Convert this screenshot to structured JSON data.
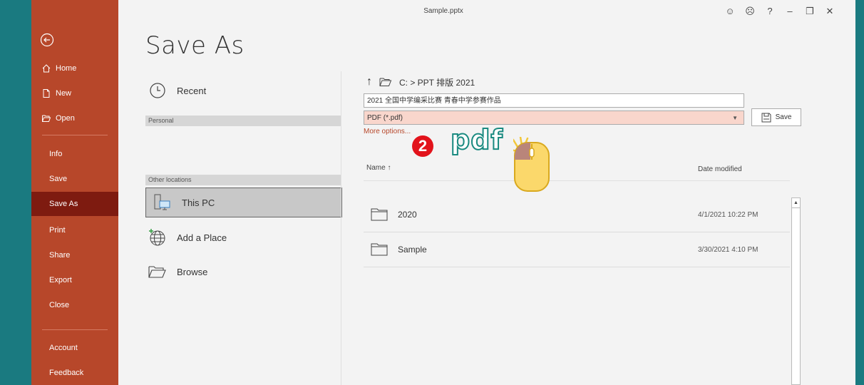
{
  "window": {
    "title": "Sample.pptx"
  },
  "titlebar": {
    "smile": "☺",
    "frown": "☹",
    "help": "?",
    "minimize": "–",
    "restore": "❐",
    "close": "✕"
  },
  "nav": {
    "items": [
      {
        "label": "Home"
      },
      {
        "label": "New"
      },
      {
        "label": "Open"
      },
      {
        "label": "Info"
      },
      {
        "label": "Save"
      },
      {
        "label": "Save As"
      },
      {
        "label": "Print"
      },
      {
        "label": "Share"
      },
      {
        "label": "Export"
      },
      {
        "label": "Close"
      },
      {
        "label": "Account"
      },
      {
        "label": "Feedback"
      }
    ]
  },
  "page": {
    "heading": "Save As"
  },
  "locations": {
    "recent": "Recent",
    "personal_header": "Personal",
    "other_header": "Other locations",
    "this_pc": "This PC",
    "add_place": "Add a Place",
    "browse": "Browse"
  },
  "save_panel": {
    "path": "C: > PPT 排版 2021",
    "filename": "2021 全国中学编采比赛 青春中学参赛作品",
    "filetype": "PDF (*.pdf)",
    "save_label": "Save",
    "more_options": "More options..."
  },
  "file_list": {
    "col_name": "Name ↑",
    "col_date": "Date modified",
    "rows": [
      {
        "name": "2020",
        "date": "4/1/2021 10:22 PM"
      },
      {
        "name": "Sample",
        "date": "3/30/2021 4:10 PM"
      }
    ]
  },
  "annotation": {
    "step": "2",
    "text": "pdf"
  }
}
